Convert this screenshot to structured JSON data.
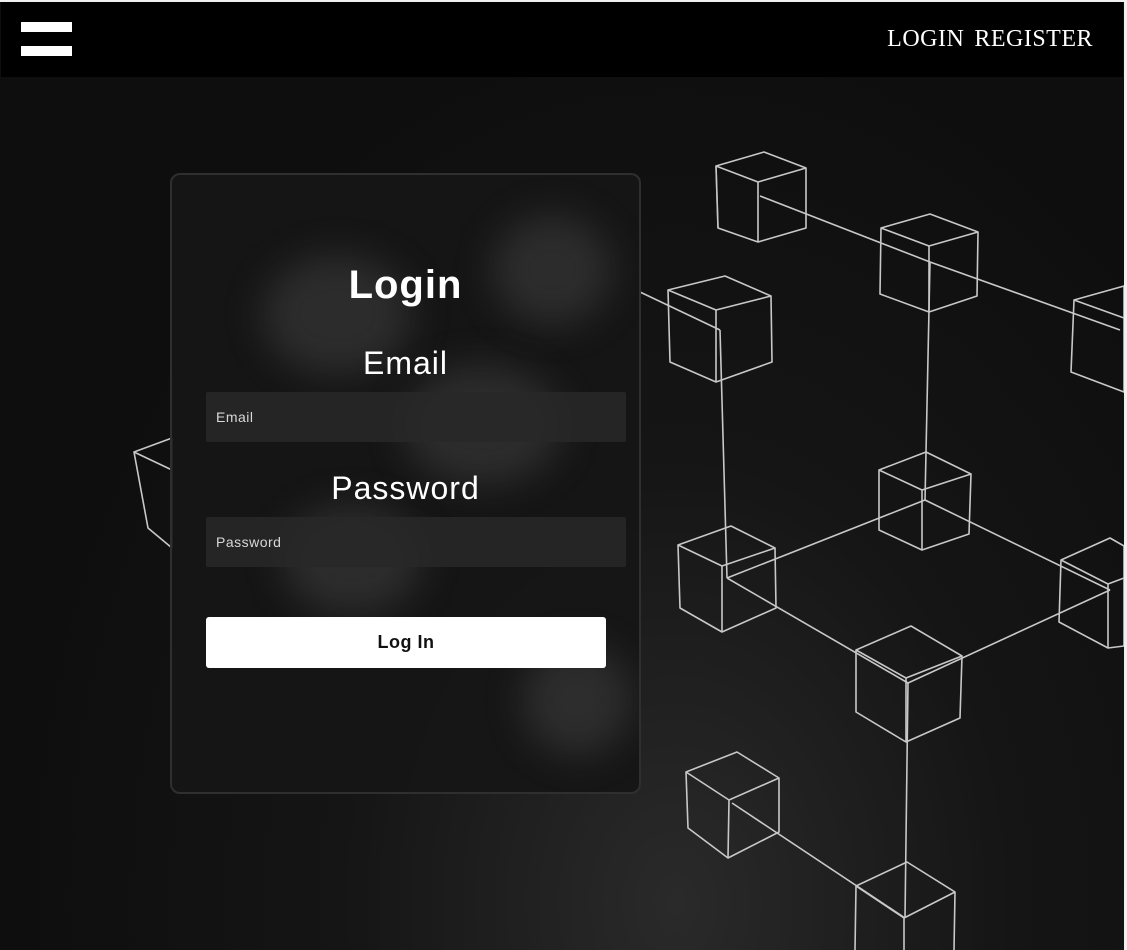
{
  "nav": {
    "menu_icon": "hamburger-menu-icon",
    "links": [
      {
        "label": "LOGIN"
      },
      {
        "label": "REGISTER"
      }
    ]
  },
  "login_card": {
    "title": "Login",
    "email": {
      "label": "Email",
      "placeholder": "Email",
      "value": ""
    },
    "password": {
      "label": "Password",
      "placeholder": "Password",
      "value": ""
    },
    "submit_label": "Log In"
  },
  "background": {
    "description_icon": "blockchain-network-icon"
  },
  "colors": {
    "navbar_bg": "#000000",
    "page_bg": "#0d0d0d",
    "button_bg": "#ffffff",
    "text": "#ffffff",
    "cube_stroke": "#cfcfcf"
  }
}
